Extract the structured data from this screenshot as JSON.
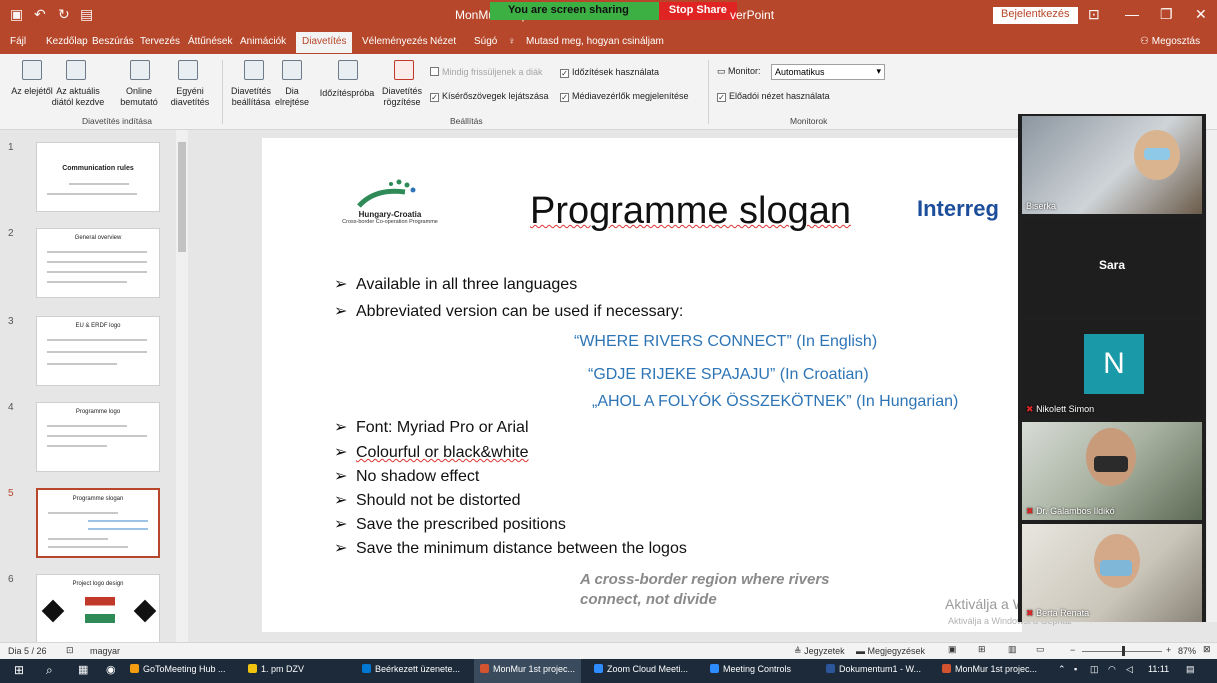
{
  "window": {
    "title": "MonMur 1st pr",
    "title_tail": "verPoint",
    "login": "Bejelentkezés"
  },
  "screen_share": {
    "status": "You are screen sharing",
    "stop": "Stop Share"
  },
  "tabs": [
    "Fájl",
    "Kezdőlap",
    "Beszúrás",
    "Tervezés",
    "Áttűnések",
    "Animációk",
    "Diavetítés",
    "Véleményezés",
    "Nézet",
    "Súgó",
    "Mutasd meg, hogyan csináljam"
  ],
  "share_button": "Megosztás",
  "ribbon": {
    "start": {
      "from_beginning": "Az elejétől",
      "from_current": "Az aktuális diától kezdve",
      "online": "Online bemutató",
      "custom": "Egyéni diavetítés",
      "group": "Diavetítés indítása"
    },
    "setup": {
      "setup": "Diavetítés beállítása",
      "hide": "Dia elrejtése",
      "rehearse": "Időzítéspróba",
      "record": "Diavetítés rögzítése",
      "keep_updated": "Mindig frissüljenek a diák",
      "play_narrations": "Kísérőszövegek lejátszása",
      "use_timings": "Időzítések használata",
      "show_media": "Médiavezérlők megjelenítése",
      "group": "Beállítás"
    },
    "monitors": {
      "monitor_label": "Monitor:",
      "monitor_value": "Automatikus",
      "presenter_view": "Előadói nézet használata",
      "group": "Monitorok"
    }
  },
  "thumbnails": [
    {
      "num": "1",
      "title": "Communication rules"
    },
    {
      "num": "2",
      "title": "General overview"
    },
    {
      "num": "3",
      "title": "EU & ERDF logo"
    },
    {
      "num": "4",
      "title": "Programme logo"
    },
    {
      "num": "5",
      "title": "Programme slogan"
    },
    {
      "num": "6",
      "title": "Project logo design"
    }
  ],
  "slide": {
    "title": "Programme slogan",
    "logo_name": "Hungary-Croatia",
    "logo_sub": "Cross-border Co-operation Programme",
    "interreg": "Interreg",
    "bullets_top": [
      "Available in all three languages",
      "Abbreviated version can be used if necessary:"
    ],
    "slogans": [
      "“WHERE RIVERS CONNECT” (In English)",
      "“GDJE RIJEKE SPAJAJU” (In Croatian)",
      "„AHOL A FOLYÓK ÖSSZEKÖTNEK” (In Hungarian)"
    ],
    "bullets_bottom": [
      "Font: Myriad Pro or Arial",
      "Colourful or black&white",
      "No shadow effect",
      "Should not be distorted",
      "Save the prescribed positions",
      "Save the minimum distance between the logos"
    ],
    "tagline": [
      "A cross-border region where rivers",
      "connect, not divide"
    ]
  },
  "activate": {
    "line1": "Aktiválja a Windowst",
    "line2": "Aktiválja a Windowst a Gépház"
  },
  "participants": [
    {
      "name": "Biserka"
    },
    {
      "name": "Sara"
    },
    {
      "name": "Nikolett Simon",
      "initial": "N"
    },
    {
      "name": "Dr. Galambos Ildikó"
    },
    {
      "name": "Berta Renata"
    }
  ],
  "status": {
    "slide": "Dia 5 / 26",
    "language": "magyar",
    "notes": "Jegyzetek",
    "comments": "Megjegyzések",
    "zoom": "87%"
  },
  "taskbar": {
    "apps": [
      "GoToMeeting Hub ...",
      "1. pm DZV",
      "Beérkezett üzenete...",
      "MonMur 1st projec...",
      "Zoom Cloud Meeti...",
      "Meeting Controls",
      "Dokumentum1 - W...",
      "MonMur 1st projec..."
    ],
    "time": "11:11"
  },
  "colors": {
    "accent": "#b7472a",
    "slogan_blue": "#2e75b6",
    "interreg_blue": "#1d4e9b"
  }
}
